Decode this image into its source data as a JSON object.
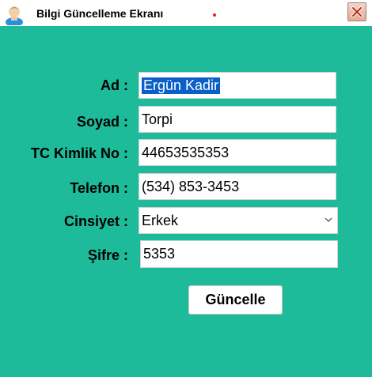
{
  "window": {
    "title": "Bilgi Güncelleme Ekranı",
    "app_icon": "user-avatar-icon",
    "close_icon": "close-icon"
  },
  "form": {
    "ad": {
      "label": "Ad :",
      "value": "Ergün Kadir"
    },
    "soyad": {
      "label": "Soyad :",
      "value": "Torpi"
    },
    "tc": {
      "label": "TC Kimlik No :",
      "value": "44653535353"
    },
    "telefon": {
      "label": "Telefon :",
      "value": "(534) 853-3453"
    },
    "cinsiyet": {
      "label": "Cinsiyet :",
      "value": "Erkek"
    },
    "sifre": {
      "label": "Şifre :",
      "value": "5353"
    }
  },
  "buttons": {
    "update": "Güncelle"
  },
  "colors": {
    "panel": "#1dbb9a",
    "selection": "#0a5fc9"
  }
}
